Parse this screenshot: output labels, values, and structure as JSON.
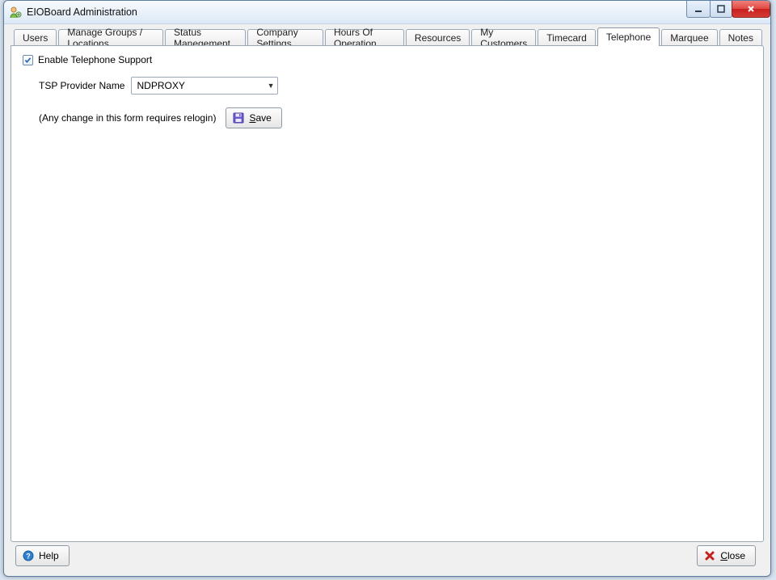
{
  "window": {
    "title": "EIOBoard Administration"
  },
  "tabs": [
    {
      "label": "Users",
      "active": false
    },
    {
      "label": "Manage Groups / Locations",
      "active": false
    },
    {
      "label": "Status Manegement",
      "active": false
    },
    {
      "label": "Company Settings",
      "active": false
    },
    {
      "label": "Hours Of Operation",
      "active": false
    },
    {
      "label": "Resources",
      "active": false
    },
    {
      "label": "My Customers",
      "active": false
    },
    {
      "label": "Timecard",
      "active": false
    },
    {
      "label": "Telephone",
      "active": true
    },
    {
      "label": "Marquee",
      "active": false
    },
    {
      "label": "Notes",
      "active": false
    }
  ],
  "telephone_panel": {
    "enable_label": "Enable Telephone Support",
    "enable_checked": true,
    "tsp_label": "TSP Provider Name",
    "tsp_value": "NDPROXY",
    "hint": "(Any change in this form requires relogin)",
    "save_label": "Save"
  },
  "footer": {
    "help_label": "Help",
    "close_label": "Close"
  }
}
